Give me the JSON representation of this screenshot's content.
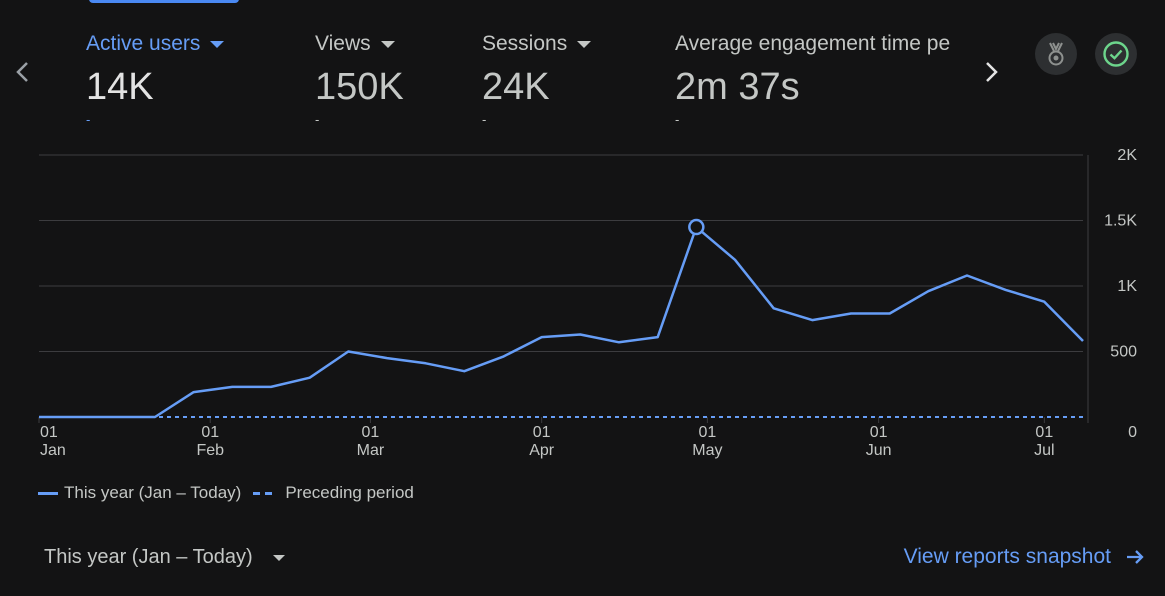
{
  "metrics": [
    {
      "label": "Active users",
      "value": "14K",
      "delta": "-"
    },
    {
      "label": "Views",
      "value": "150K",
      "delta": "-"
    },
    {
      "label": "Sessions",
      "value": "24K",
      "delta": "-"
    },
    {
      "label": "Average engagement time pe",
      "value": "2m 37s",
      "delta": "-"
    }
  ],
  "icons": {
    "prev": "chevron-left-icon",
    "next": "chevron-right-icon",
    "insights": "ribbon-badge-icon",
    "status": "check-circle-icon",
    "snapshot": "arrow-right-icon"
  },
  "colors": {
    "background": "#131314",
    "accent": "#669df6",
    "grid": "#3c3c3f",
    "status": "#6dd58c"
  },
  "legend": {
    "this_period": "This year (Jan – Today)",
    "preceding": "Preceding period"
  },
  "footer": {
    "date_range": "This year (Jan – Today)",
    "snapshot_link": "View reports snapshot"
  },
  "chart_data": {
    "type": "line",
    "title": "",
    "xlabel": "",
    "ylabel": "",
    "x_start": "2024-01-01",
    "x_interval_days": 7,
    "x_ticks": [
      {
        "day": "01",
        "month": "Jan",
        "date": "2024-01-01"
      },
      {
        "day": "01",
        "month": "Feb",
        "date": "2024-02-01"
      },
      {
        "day": "01",
        "month": "Mar",
        "date": "2024-03-01"
      },
      {
        "day": "01",
        "month": "Apr",
        "date": "2024-04-01"
      },
      {
        "day": "01",
        "month": "May",
        "date": "2024-05-01"
      },
      {
        "day": "01",
        "month": "Jun",
        "date": "2024-06-01"
      },
      {
        "day": "01",
        "month": "Jul",
        "date": "2024-07-01"
      }
    ],
    "y_ticks": [
      "0",
      "500",
      "1K",
      "1.5K",
      "2K"
    ],
    "y_tick_values": [
      0,
      500,
      1000,
      1500,
      2000
    ],
    "ylim": [
      0,
      2000
    ],
    "grid": true,
    "legend_position": "bottom-left",
    "highlight_index": 17,
    "series": [
      {
        "name": "This year (Jan – Today)",
        "style": "solid",
        "values": [
          0,
          0,
          0,
          0,
          190,
          230,
          230,
          300,
          500,
          450,
          410,
          350,
          460,
          610,
          630,
          570,
          610,
          1450,
          1200,
          830,
          740,
          790,
          790,
          960,
          1080,
          970,
          880,
          580
        ]
      },
      {
        "name": "Preceding period",
        "style": "dashed",
        "values": [
          0,
          0,
          0,
          0,
          0,
          0,
          0,
          0,
          0,
          0,
          0,
          0,
          0,
          0,
          0,
          0,
          0,
          0,
          0,
          0,
          0,
          0,
          0,
          0,
          0,
          0,
          0,
          0
        ]
      }
    ]
  }
}
